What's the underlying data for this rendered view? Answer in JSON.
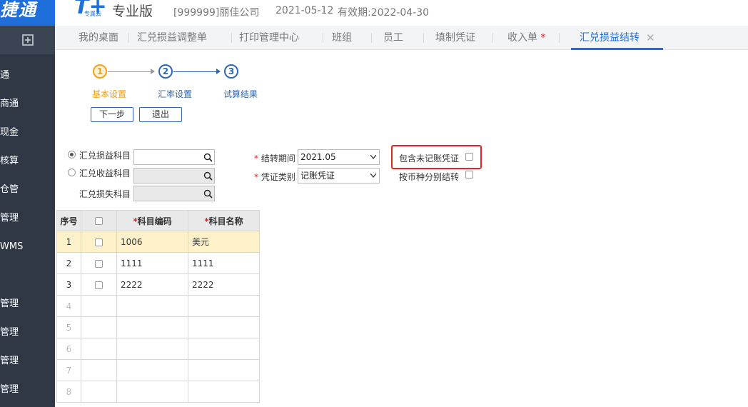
{
  "header": {
    "brand_left": "捷通",
    "logo_sub": "专属云",
    "edition": "专业版",
    "company": "[999999]丽佳公司",
    "date": "2021-05-12",
    "validity": "有效期:2022-04-30"
  },
  "sidebar": {
    "items": [
      {
        "label": "通"
      },
      {
        "label": "商通"
      },
      {
        "label": "现金"
      },
      {
        "label": "核算"
      },
      {
        "label": "仓管"
      },
      {
        "label": "管理"
      },
      {
        "label": "WMS"
      },
      {
        "label": "管理"
      },
      {
        "label": "管理"
      },
      {
        "label": "管理"
      },
      {
        "label": "管理"
      }
    ]
  },
  "tabs": [
    {
      "label": "我的桌面"
    },
    {
      "label": "汇兑损益调整单"
    },
    {
      "label": "打印管理中心"
    },
    {
      "label": "班组"
    },
    {
      "label": "员工"
    },
    {
      "label": "填制凭证"
    },
    {
      "label": "收入单",
      "marker": "*"
    },
    {
      "label": "汇兑损益结转",
      "active": true
    }
  ],
  "wizard": {
    "steps": [
      {
        "num": "1",
        "label": "基本设置",
        "current": true
      },
      {
        "num": "2",
        "label": "汇率设置"
      },
      {
        "num": "3",
        "label": "试算结果"
      }
    ],
    "buttons": {
      "next": "下一步",
      "exit": "退出"
    }
  },
  "form": {
    "radio_gain": "汇兑损益科目",
    "radio_income": "汇兑收益科目",
    "loss_label": "汇兑损失科目",
    "period_label": "结转期间",
    "period_value": "2021.05",
    "voucher_type_label": "凭证类别",
    "voucher_type_value": "记账凭证",
    "required_marker": "*",
    "include_unposted": "包含未记账凭证",
    "by_currency": "按币种分别结转"
  },
  "table": {
    "headers": {
      "seq": "序号",
      "code": "科目编码",
      "name": "科目名称",
      "required_marker": "*"
    },
    "rows": [
      {
        "seq": "1",
        "code": "1006",
        "name": "美元"
      },
      {
        "seq": "2",
        "code": "1111",
        "name": "1111"
      },
      {
        "seq": "3",
        "code": "2222",
        "name": "2222"
      },
      {
        "seq": "4",
        "code": "",
        "name": ""
      },
      {
        "seq": "5",
        "code": "",
        "name": ""
      },
      {
        "seq": "6",
        "code": "",
        "name": ""
      },
      {
        "seq": "7",
        "code": "",
        "name": ""
      },
      {
        "seq": "8",
        "code": "",
        "name": ""
      }
    ]
  },
  "colors": {
    "accent": "#1e6fd9",
    "sidebar": "#2f3844",
    "step_current": "#f3a11c",
    "step": "#2f67b1",
    "highlight": "#e0291f",
    "selected_row": "#fdf1c9"
  }
}
